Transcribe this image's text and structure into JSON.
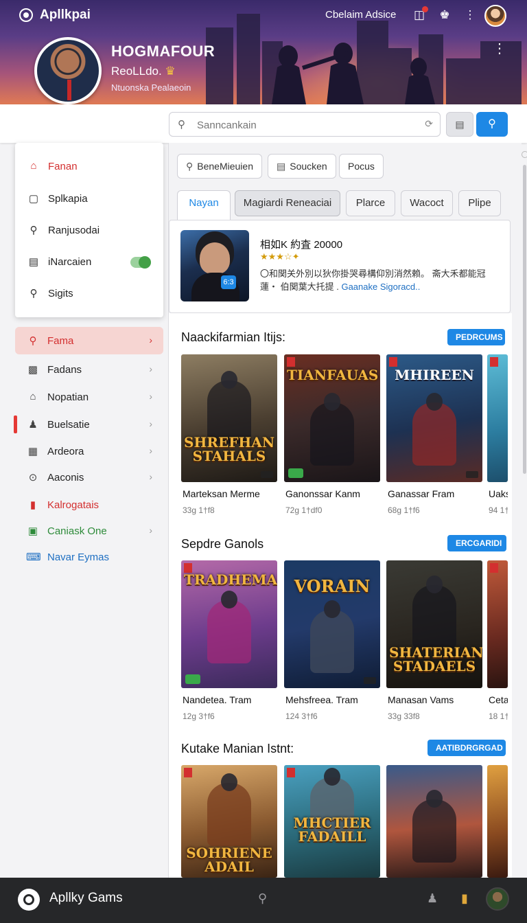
{
  "app": {
    "title": "Apllkpai",
    "top_link": "Cbelaim Adsice"
  },
  "profile": {
    "name": "HOGMAFOUR",
    "subtitle": "ReoLLdo.",
    "tagline": "Ntuonska Pealaeoin"
  },
  "search": {
    "placeholder": "Sanncankain"
  },
  "dropdown": [
    {
      "label": "Fanan",
      "icon": "home-icon",
      "active": true
    },
    {
      "label": "Splkapia",
      "icon": "square-icon"
    },
    {
      "label": "Ranjusodai",
      "icon": "search-icon"
    },
    {
      "label": "iNarcaien",
      "icon": "square-icon",
      "toggle": true
    },
    {
      "label": "Sigits",
      "icon": "search-icon"
    }
  ],
  "nav": [
    {
      "label": "Fama",
      "icon": "search-icon",
      "active": true,
      "chevron": true
    },
    {
      "label": "Fadans",
      "icon": "briefcase-icon",
      "chevron": true
    },
    {
      "label": "Nopatian",
      "icon": "house-icon",
      "chevron": true
    },
    {
      "label": "Buelsatie",
      "icon": "user-icon",
      "chevron": true
    },
    {
      "label": "Ardeora",
      "icon": "grid-icon",
      "chevron": true
    },
    {
      "label": "Aaconis",
      "icon": "circle-icon",
      "chevron": true
    },
    {
      "label": "Kalrogatais",
      "icon": "bookmark-icon",
      "color": "red"
    },
    {
      "label": "Caniask One",
      "icon": "chat-icon",
      "color": "green",
      "chevron": true
    },
    {
      "label": "Navar Eymas",
      "icon": "keyboard-icon",
      "color": "blue"
    }
  ],
  "filter_chips": [
    "BeneMieuien",
    "Soucken",
    "Pocus"
  ],
  "tabs": [
    "Nayan",
    "Magiardi Reneaciai",
    "Plarce",
    "Wacoct",
    "Plipe"
  ],
  "featured": {
    "title": "相如K 約査 20000",
    "stars": "★★★☆✦",
    "badge": "6:3",
    "desc": "〇和関关外別以狄你掛哭尋構仰別消然賴。 斋大禾都能冠蓮・ 伯関葉大托提 .",
    "link": "Gaanake Sigoracd.."
  },
  "sections": [
    {
      "title": "Naackifarmian Itijs:",
      "button": "PEDRCUMS",
      "cards": [
        {
          "name": "Marteksan Merme",
          "meta": "33g 1†f8",
          "cover": "SHREFHAN STAHALS"
        },
        {
          "name": "Ganonssar Kanm",
          "meta": "72g 1†df0",
          "cover": "TIANFAUAS"
        },
        {
          "name": "Ganassar Fram",
          "meta": "68g 1†f6",
          "cover": "MHIREEN"
        },
        {
          "name": "Uaks",
          "meta": "94 1†f",
          "cover": ""
        }
      ]
    },
    {
      "title": "Sepdre Ganols",
      "button": "ERCGARIDI",
      "cards": [
        {
          "name": "Nandetea. Tram",
          "meta": "12g 3†f6",
          "cover": "TRADHEMAK"
        },
        {
          "name": "Mehsfreea. Tram",
          "meta": "124 3†f6",
          "cover": "VORAIN"
        },
        {
          "name": "Manasan Vams",
          "meta": "33g 33f8",
          "cover": "SHATERIAN STADAELS"
        },
        {
          "name": "Ceta",
          "meta": "18 1†",
          "cover": ""
        }
      ]
    },
    {
      "title": "Kutake Manian Istnt:",
      "button": "AATIBDRGRGAD",
      "cards": [
        {
          "name": "",
          "meta": "",
          "cover": "SOHRIENE ADAIL"
        },
        {
          "name": "",
          "meta": "",
          "cover": "MHCTIER FADAILL"
        },
        {
          "name": "",
          "meta": "",
          "cover": ""
        },
        {
          "name": "",
          "meta": "",
          "cover": ""
        }
      ]
    }
  ],
  "bottom": {
    "title": "Apllky Gams"
  },
  "colors": {
    "accent": "#1e88e5",
    "active_red": "#d32f2f",
    "bottom_bar": "#262729"
  }
}
